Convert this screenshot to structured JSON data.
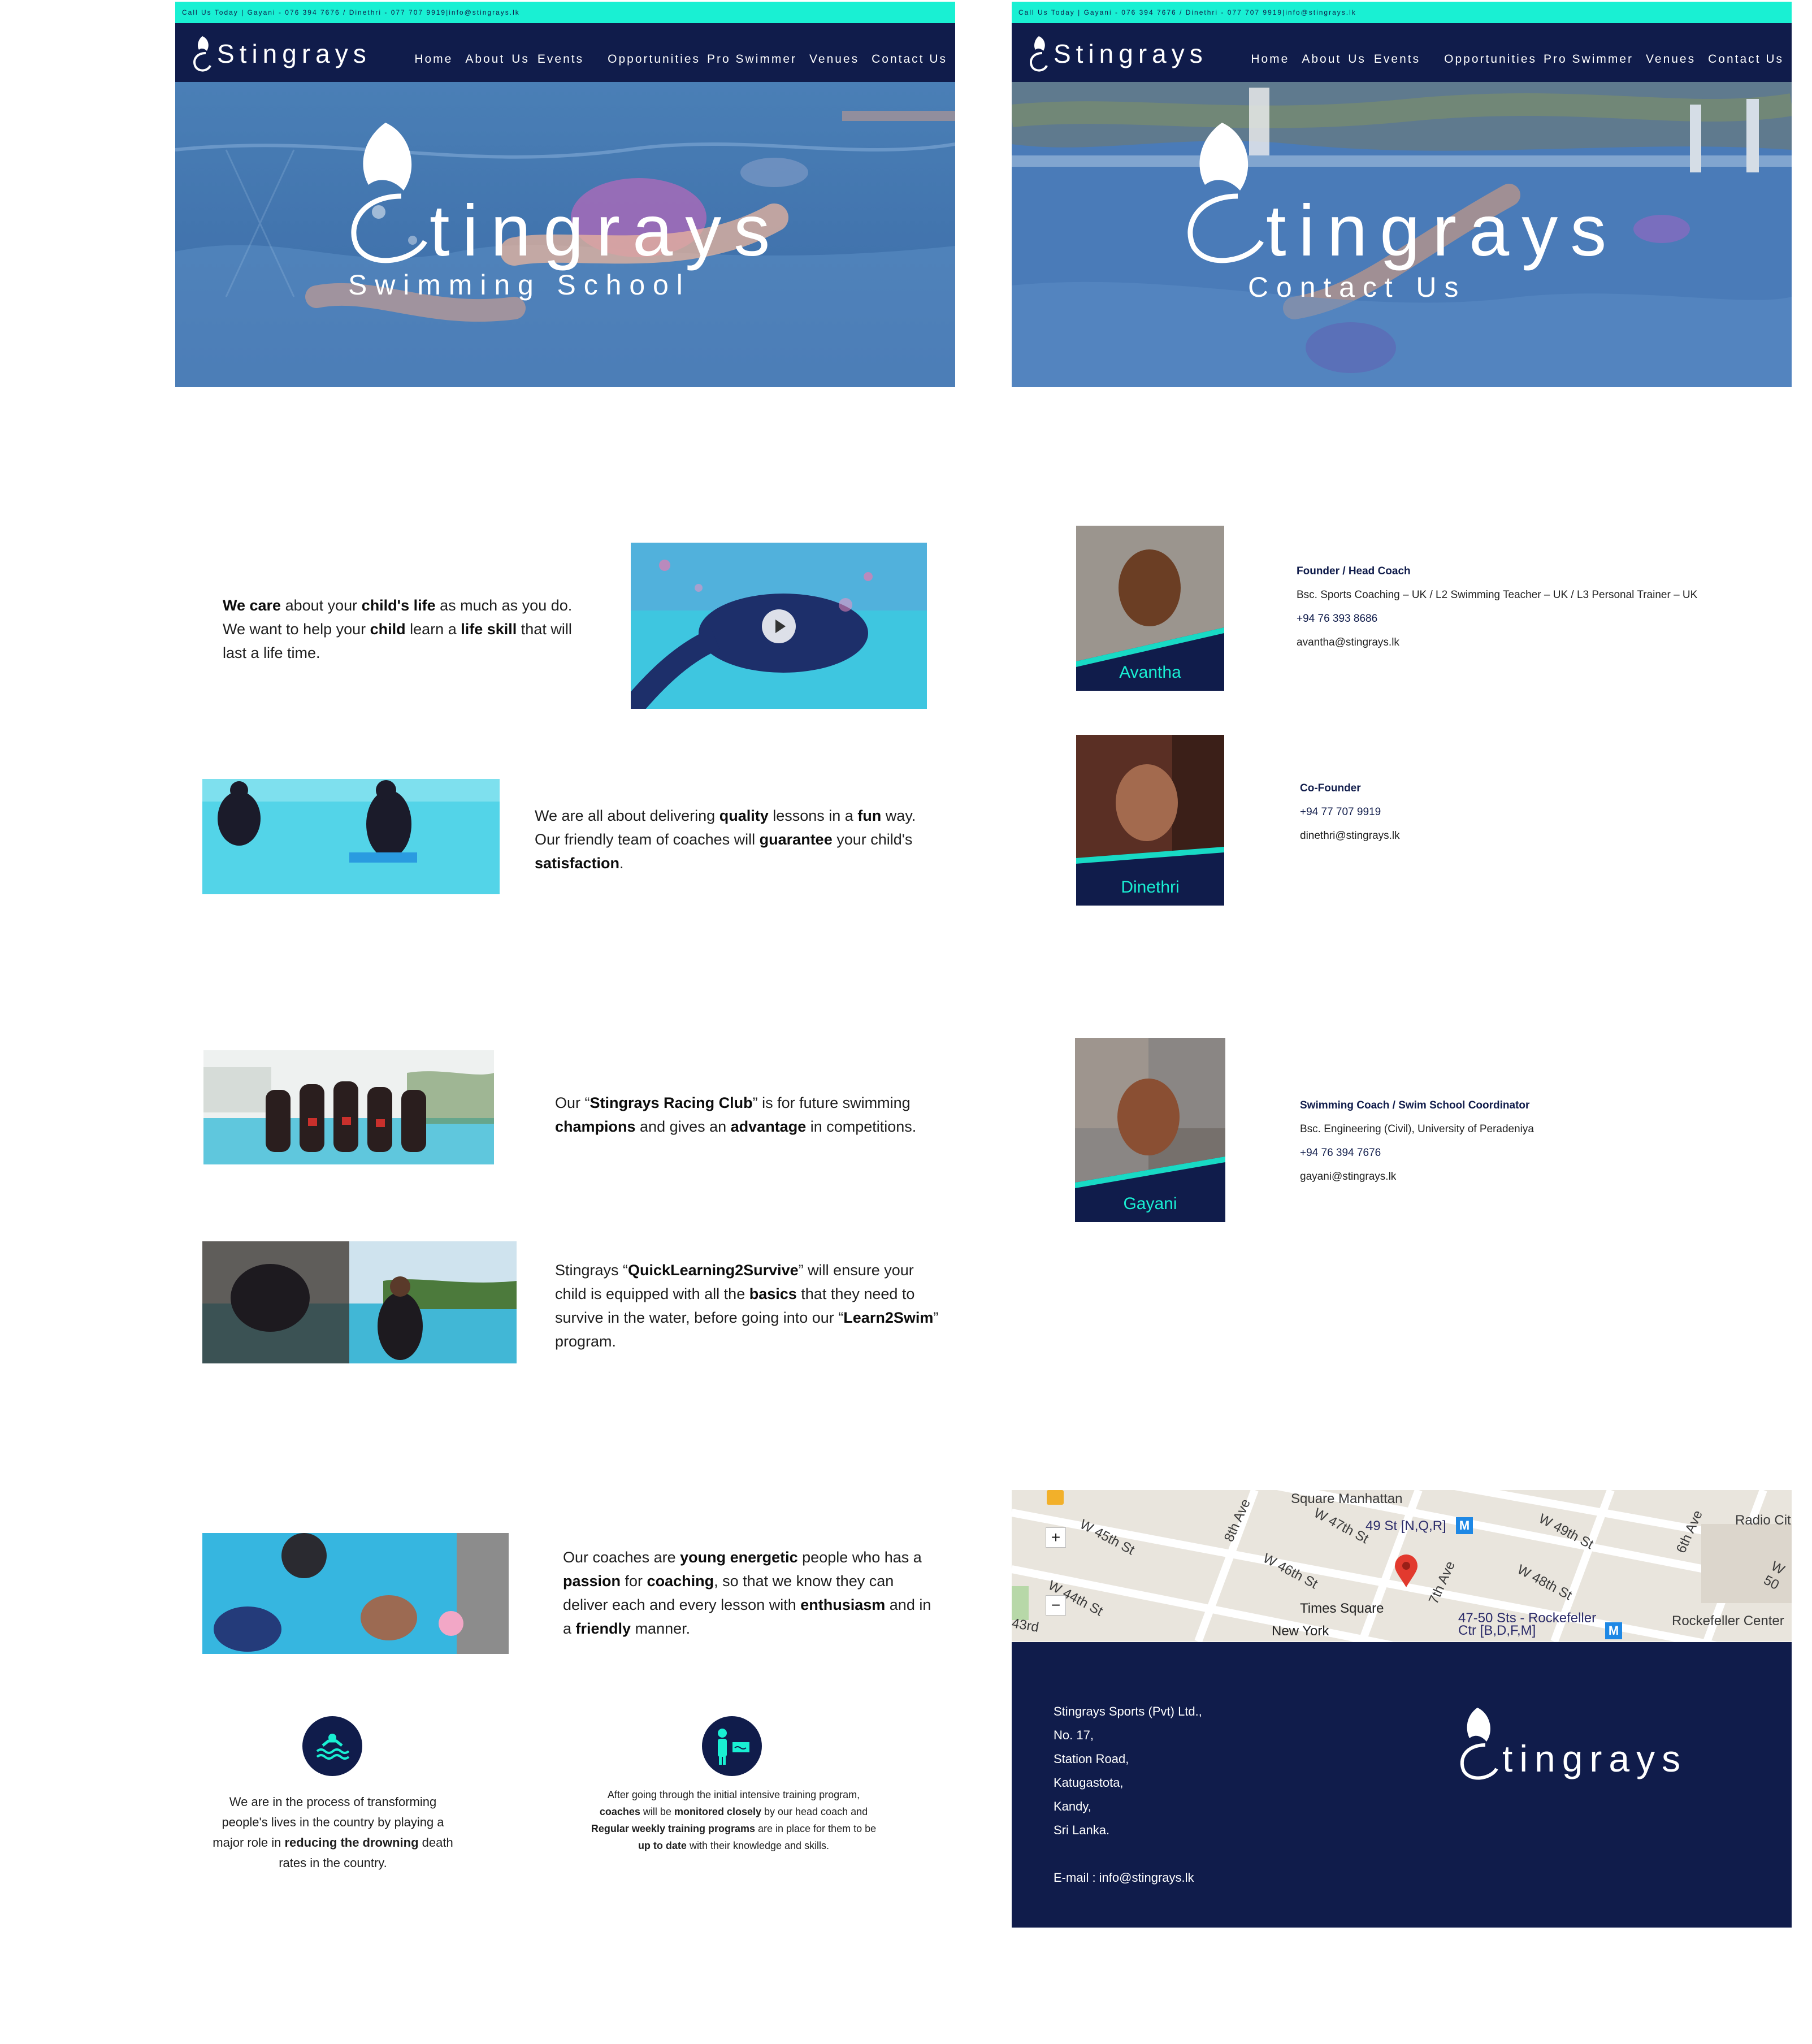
{
  "site": {
    "brand": "Stingrays",
    "topbar_text": "Call Us Today | Gayani - 076 394 7676 / Dinethri - 077 707 9919|info@stingrays.lk",
    "nav": [
      "Home",
      "About",
      "Us",
      "Events",
      "Opportunities",
      "Pro Swimmer",
      "Venues",
      "Contact Us"
    ]
  },
  "home": {
    "hero_title": "tingrays",
    "hero_subtitle": "S w i m m i n g   S c h o o l",
    "intro": {
      "parts": [
        "We care",
        " about your ",
        "child's life",
        " as much as you do. We want to help your ",
        "child",
        " learn a ",
        "life skill",
        " that will last a life time."
      ]
    },
    "quality": {
      "parts": [
        "We are all about delivering ",
        "quality",
        " lessons in a ",
        "fun",
        " way. Our friendly team of coaches will ",
        "guarantee",
        " your child's ",
        "satisfaction",
        "."
      ]
    },
    "racing": {
      "parts": [
        "Our “",
        "Stingrays Racing Club",
        "” is for future swimming ",
        "champions",
        " and gives an ",
        "advantage",
        " in competitions."
      ]
    },
    "survive": {
      "parts": [
        "Stingrays “",
        "QuickLearning2Survive",
        "” will ensure your child is equipped with all the ",
        "basics",
        " that they need to survive in the water, before going into our “",
        "Learn2Swim",
        "” program."
      ]
    },
    "coaches": {
      "parts": [
        "Our coaches are ",
        "young energetic",
        " people who has a ",
        "passion",
        " for ",
        "coaching",
        ", so that we know they can deliver each and every lesson with ",
        "enthusiasm",
        " and in a ",
        "friendly",
        " manner."
      ]
    },
    "feature1": {
      "parts": [
        "We are in the process of transforming people's lives in the country by playing a major role in ",
        "reducing the drowning",
        " death rates in the country."
      ]
    },
    "feature2": {
      "parts": [
        "After going through the initial intensive training program, ",
        "coaches",
        " will be ",
        "monitored closely",
        " by our head coach and ",
        "Regular weekly training programs",
        " are in place for them to be ",
        "up to date",
        " with their knowledge and skills."
      ]
    }
  },
  "contact": {
    "hero_title": "tingrays",
    "hero_subtitle": "C o n t a c t   U s",
    "staff": [
      {
        "name": "Avantha",
        "role": "Founder / Head Coach",
        "qualification": "Bsc. Sports Coaching – UK / L2 Swimming Teacher – UK / L3 Personal Trainer – UK",
        "phone": "+94 76 393 8686",
        "email": "avantha@stingrays.lk"
      },
      {
        "name": "Dinethri",
        "role": "Co-Founder",
        "qualification": "",
        "phone": "+94 77 707 9919",
        "email": "dinethri@stingrays.lk"
      },
      {
        "name": "Gayani",
        "role": "Swimming Coach / Swim School Coordinator",
        "qualification": "Bsc. Engineering (Civil), University of Peradeniya",
        "phone": "+94 76 394 7676",
        "email": "gayani@stingrays.lk"
      }
    ],
    "map_labels": [
      "Square Manhattan",
      "W 47th St",
      "49 St [N,Q,R]",
      "W 49th St",
      "Radio Cit",
      "W 45th St",
      "8th Ave",
      "W 46th St",
      "7th Ave",
      "W 48th St",
      "6th Ave",
      "W 44th St",
      "Times Square",
      "47-50 Sts - Rockefeller Ctr [B,D,F,M]",
      "Rockefeller Center",
      "New York",
      "43rd",
      "W 50"
    ],
    "address": [
      "Stingrays Sports (Pvt) Ltd.,",
      "No. 17,",
      "Station Road,",
      "Katugastota,",
      "Kandy,",
      "Sri Lanka."
    ],
    "email_line": "E-mail : info@stingrays.lk"
  },
  "colors": {
    "navy": "#101c4b",
    "accent": "#19f0d3"
  }
}
